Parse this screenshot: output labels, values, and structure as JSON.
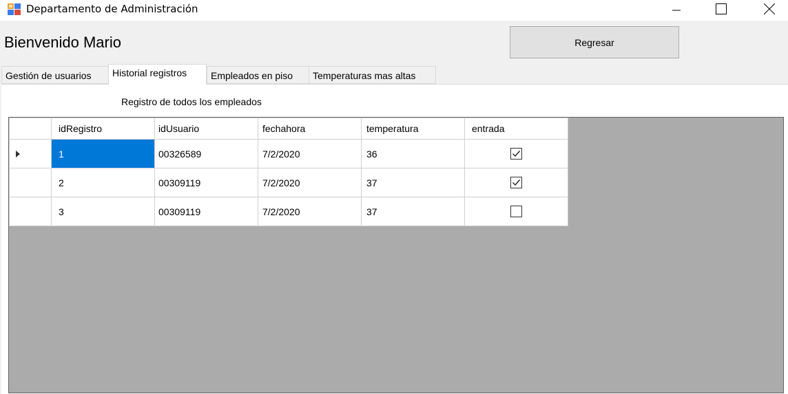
{
  "window": {
    "title": "Departamento de Administración"
  },
  "header": {
    "welcome": "Bienvenido Mario",
    "back_button": "Regresar"
  },
  "tabs": [
    {
      "label": "Gestión de usuarios",
      "active": false
    },
    {
      "label": "Historial registros",
      "active": true
    },
    {
      "label": "Empleados en piso",
      "active": false
    },
    {
      "label": "Temperaturas mas altas",
      "active": false
    }
  ],
  "content": {
    "section_label": "Registro de todos los empleados"
  },
  "grid": {
    "columns": [
      "idRegistro",
      "idUsuario",
      "fechahora",
      "temperatura",
      "entrada"
    ],
    "rows": [
      {
        "idRegistro": "1",
        "idUsuario": "00326589",
        "fechahora": "7/2/2020",
        "temperatura": "36",
        "entrada": true,
        "current": true
      },
      {
        "idRegistro": "2",
        "idUsuario": "00309119",
        "fechahora": "7/2/2020",
        "temperatura": "37",
        "entrada": true,
        "current": false
      },
      {
        "idRegistro": "3",
        "idUsuario": "00309119",
        "fechahora": "7/2/2020",
        "temperatura": "37",
        "entrada": false,
        "current": false
      }
    ],
    "selection_color": "#0078d7",
    "background_color": "#ababab"
  },
  "icons": {
    "app": "app-window-icon",
    "minimize": "minimize-icon",
    "maximize": "maximize-icon",
    "close": "close-icon",
    "row_indicator": "row-indicator-arrow-icon",
    "checkbox": "checkbox-icon"
  }
}
